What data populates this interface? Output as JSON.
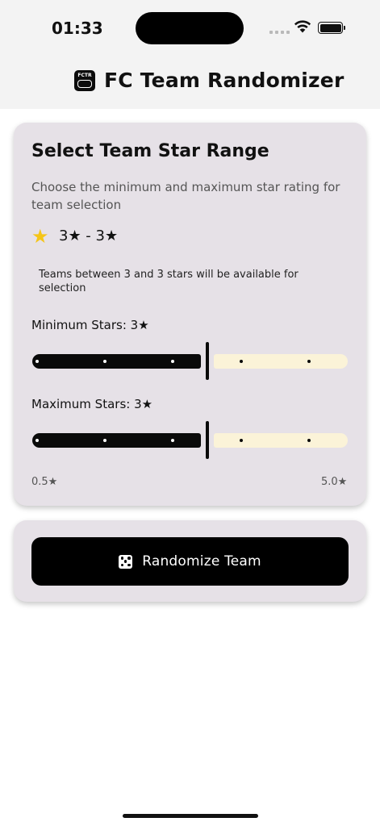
{
  "status_bar": {
    "time": "01:33"
  },
  "app": {
    "title": "FC Team Randomizer",
    "logo_text": "FCTR"
  },
  "range_card": {
    "title": "Select Team Star Range",
    "description": "Choose the minimum and maximum star rating for team selection",
    "star_icon": "star-icon",
    "summary": "3★ - 3★",
    "info": "Teams between 3 and 3 stars will be available for selection",
    "min_slider": {
      "label": "Minimum Stars: 3★",
      "value": 3
    },
    "max_slider": {
      "label": "Maximum Stars: 3★",
      "value": 3
    },
    "scale": {
      "min": 0.5,
      "max": 5.0,
      "step": 0.5,
      "min_label": "0.5★",
      "max_label": "5.0★"
    }
  },
  "action_card": {
    "button_label": "Randomize Team",
    "button_icon": "dice-icon"
  },
  "colors": {
    "card_bg": "#e6e1e7",
    "track_active": "#0a0a0a",
    "track_inactive": "#fbf3d8",
    "star_gold": "#f5c518",
    "button_bg": "#000000"
  }
}
